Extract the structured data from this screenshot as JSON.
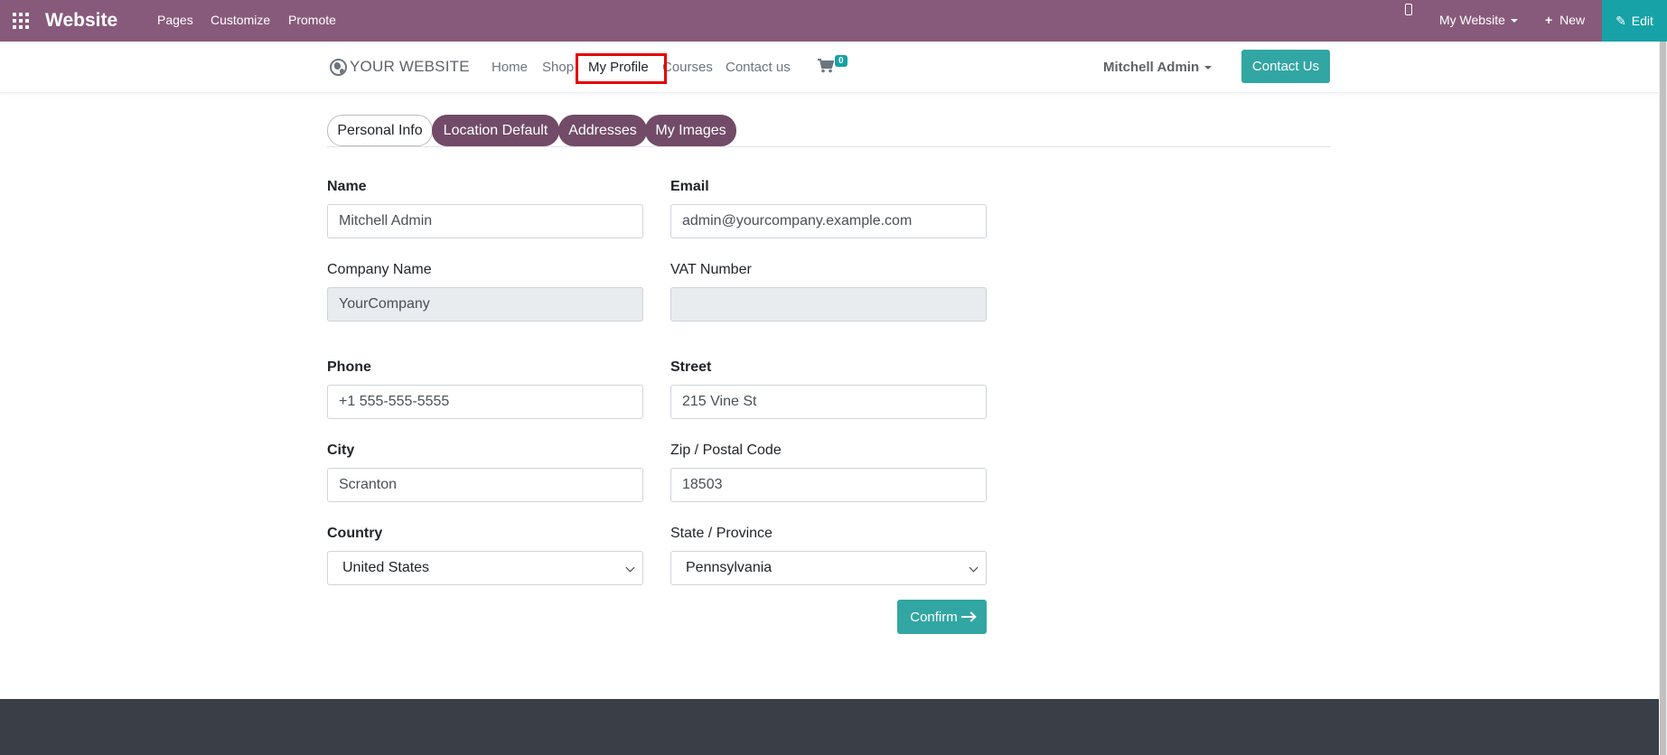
{
  "topbar": {
    "brand": "Website",
    "menu": [
      "Pages",
      "Customize",
      "Promote"
    ],
    "website_selector": "My Website",
    "new_label": "New",
    "edit_label": "Edit"
  },
  "header": {
    "logo_text": "YOUR WEBSITE",
    "nav": [
      "Home",
      "Shop",
      "My Profile",
      "Courses",
      "Contact us"
    ],
    "cart_count": "0",
    "user_name": "Mitchell Admin",
    "contact_button": "Contact Us"
  },
  "tabs": [
    "Personal Info",
    "Location Default",
    "Addresses",
    "My Images"
  ],
  "form": {
    "name": {
      "label": "Name",
      "value": "Mitchell Admin"
    },
    "email": {
      "label": "Email",
      "value": "admin@yourcompany.example.com"
    },
    "company": {
      "label": "Company Name",
      "value": "YourCompany"
    },
    "vat": {
      "label": "VAT Number",
      "value": ""
    },
    "phone": {
      "label": "Phone",
      "value": "+1 555-555-5555"
    },
    "street": {
      "label": "Street",
      "value": "215 Vine St"
    },
    "city": {
      "label": "City",
      "value": "Scranton"
    },
    "zip": {
      "label": "Zip / Postal Code",
      "value": "18503"
    },
    "country": {
      "label": "Country",
      "value": "United States"
    },
    "state": {
      "label": "State / Province",
      "value": "Pennsylvania"
    },
    "confirm_label": "Confirm"
  },
  "colors": {
    "topbar": "#875a7b",
    "tab_inactive": "#714b67",
    "accent": "#32a6a3",
    "edit": "#17a2a8",
    "highlight": "#e50000"
  }
}
